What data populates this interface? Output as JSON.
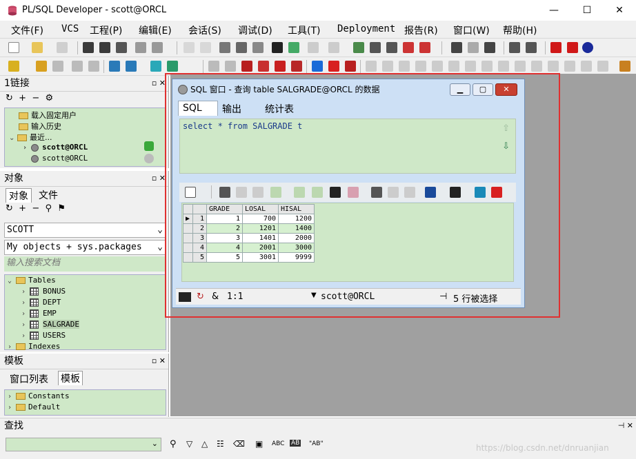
{
  "app": {
    "title": "PL/SQL Developer - scott@ORCL",
    "window_buttons": [
      "—",
      "☐",
      "✕"
    ]
  },
  "menu": [
    "文件(F)",
    "VCS",
    "工程(P)",
    "编辑(E)",
    "会话(S)",
    "调试(D)",
    "工具(T)",
    "Deployment",
    "报告(R)",
    "窗口(W)",
    "帮助(H)"
  ],
  "connections_panel": {
    "title": "1链接",
    "items": [
      {
        "label": "载入固定用户",
        "icon": "folder-icon"
      },
      {
        "label": "输入历史",
        "icon": "folder-icon"
      },
      {
        "label": "最近...",
        "icon": "folder-icon"
      },
      {
        "label": "scott@ORCL",
        "icon": "database-icon",
        "bold": true
      },
      {
        "label": "scott@ORCL",
        "icon": "database-icon"
      }
    ]
  },
  "objects_panel": {
    "title": "对象",
    "tabs": [
      "对象",
      "文件"
    ],
    "user_select": "SCOTT",
    "filter_select": "My objects + sys.packages",
    "search_placeholder": "输入搜索文档",
    "tree": [
      {
        "label": "Tables",
        "type": "folder"
      },
      {
        "label": "BONUS",
        "type": "table"
      },
      {
        "label": "DEPT",
        "type": "table"
      },
      {
        "label": "EMP",
        "type": "table"
      },
      {
        "label": "SALGRADE",
        "type": "table",
        "selected": true
      },
      {
        "label": "USERS",
        "type": "table"
      },
      {
        "label": "Indexes",
        "type": "folder"
      }
    ]
  },
  "templates_panel": {
    "title": "模板",
    "tabs": [
      "窗口列表",
      "模板"
    ],
    "items": [
      "Constants",
      "Default"
    ]
  },
  "find_panel": {
    "title": "查找",
    "buttons": [
      "ABC",
      "AB",
      "\"AB\""
    ]
  },
  "sql_window": {
    "title": "SQL 窗口 - 查询 table SALGRADE@ORCL 的数据",
    "tabs": [
      "SQL",
      "输出",
      "统计表"
    ],
    "sql_text": "select * from SALGRADE t",
    "grid": {
      "columns": [
        "GRADE",
        "LOSAL",
        "HISAL"
      ],
      "rows": [
        [
          "1",
          "1",
          "700",
          "1200"
        ],
        [
          "2",
          "2",
          "1201",
          "1400"
        ],
        [
          "3",
          "3",
          "1401",
          "2000"
        ],
        [
          "4",
          "4",
          "2001",
          "3000"
        ],
        [
          "5",
          "5",
          "3001",
          "9999"
        ]
      ]
    },
    "status": {
      "amp": "&",
      "position": "1:1",
      "connection": "scott@ORCL",
      "rows_selected": "5 行被选择"
    }
  },
  "watermark": "https://blog.csdn.net/dnruanjian",
  "colors": {
    "panel_green": "#cfe8c8",
    "highlight_red": "#e03030",
    "workspace_gray": "#a0a0a0"
  }
}
